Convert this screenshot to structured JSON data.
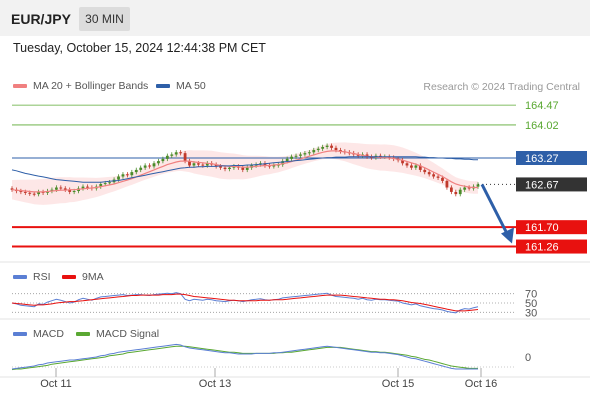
{
  "header": {
    "symbol": "EUR/JPY",
    "interval": "30 MIN",
    "datetime": "Tuesday, October 15, 2024 12:44:38 PM CET",
    "credit": "Research © 2024 Trading Central"
  },
  "legend": {
    "ma20": "MA 20 + Bollinger Bands",
    "ma50": "MA 50",
    "rsi": "RSI",
    "rsi_ma": "9MA",
    "macd": "MACD",
    "macd_signal": "MACD Signal"
  },
  "colors": {
    "ma20": "#f08080",
    "ma50": "#2e5fa8",
    "bollinger_fill": "#fde3e3",
    "candle_up": "#4a8c2a",
    "candle_down": "#c0392b",
    "resistance": "#5aa832",
    "support": "#e8110f",
    "pivot": "#2e5fa8",
    "current": "#333333",
    "arrow": "#2e5fa8",
    "rsi": "#5b7fd4",
    "rsi_ma": "#e8110f",
    "macd": "#5b7fd4",
    "macd_signal": "#5aa832"
  },
  "chart_data": [
    {
      "type": "candlestick",
      "title": "EUR/JPY",
      "x_ticks": [
        "Oct 11",
        "Oct 13",
        "Oct 15",
        "Oct 16"
      ],
      "ylim": [
        161.0,
        164.7
      ],
      "levels": [
        {
          "value": 164.47,
          "label": "164.47",
          "kind": "resistance"
        },
        {
          "value": 164.02,
          "label": "164.02",
          "kind": "resistance"
        },
        {
          "value": 163.27,
          "label": "163.27",
          "kind": "pivot"
        },
        {
          "value": 162.67,
          "label": "162.67",
          "kind": "current"
        },
        {
          "value": 161.7,
          "label": "161.70",
          "kind": "support"
        },
        {
          "value": 161.26,
          "label": "161.26",
          "kind": "support"
        }
      ],
      "closes": [
        162.55,
        162.52,
        162.5,
        162.48,
        162.46,
        162.45,
        162.5,
        162.48,
        162.52,
        162.55,
        162.6,
        162.58,
        162.55,
        162.5,
        162.52,
        162.58,
        162.62,
        162.6,
        162.58,
        162.62,
        162.68,
        162.7,
        162.72,
        162.78,
        162.85,
        162.9,
        162.88,
        162.95,
        163.0,
        163.05,
        163.1,
        163.08,
        163.15,
        163.2,
        163.25,
        163.32,
        163.35,
        163.4,
        163.38,
        163.2,
        163.1,
        163.15,
        163.12,
        163.1,
        163.15,
        163.12,
        163.08,
        163.05,
        163.02,
        163.05,
        163.08,
        163.05,
        163.0,
        163.05,
        163.1,
        163.12,
        163.15,
        163.1,
        163.08,
        163.1,
        163.12,
        163.2,
        163.25,
        163.3,
        163.32,
        163.35,
        163.38,
        163.4,
        163.45,
        163.48,
        163.52,
        163.55,
        163.5,
        163.45,
        163.42,
        163.4,
        163.38,
        163.35,
        163.32,
        163.35,
        163.3,
        163.28,
        163.32,
        163.3,
        163.3,
        163.28,
        163.25,
        163.22,
        163.15,
        163.1,
        163.05,
        163.1,
        163.0,
        162.95,
        162.9,
        162.85,
        162.82,
        162.75,
        162.6,
        162.5,
        162.45,
        162.55,
        162.6,
        162.58,
        162.62,
        162.67
      ],
      "ma20": [
        162.55,
        162.54,
        162.53,
        162.52,
        162.51,
        162.5,
        162.5,
        162.5,
        162.51,
        162.52,
        162.53,
        162.54,
        162.54,
        162.55,
        162.55,
        162.56,
        162.57,
        162.58,
        162.59,
        162.6,
        162.62,
        162.64,
        162.66,
        162.68,
        162.71,
        162.74,
        162.77,
        162.8,
        162.84,
        162.88,
        162.92,
        162.96,
        163.0,
        163.04,
        163.08,
        163.12,
        163.15,
        163.18,
        163.2,
        163.2,
        163.2,
        163.18,
        163.17,
        163.16,
        163.15,
        163.14,
        163.12,
        163.1,
        163.09,
        163.08,
        163.08,
        163.07,
        163.06,
        163.06,
        163.07,
        163.08,
        163.09,
        163.1,
        163.1,
        163.11,
        163.12,
        163.14,
        163.16,
        163.19,
        163.22,
        163.25,
        163.28,
        163.31,
        163.34,
        163.37,
        163.4,
        163.42,
        163.43,
        163.43,
        163.42,
        163.41,
        163.39,
        163.37,
        163.35,
        163.33,
        163.31,
        163.3,
        163.29,
        163.28,
        163.28,
        163.27,
        163.26,
        163.24,
        163.22,
        163.19,
        163.16,
        163.13,
        163.09,
        163.05,
        163.0,
        162.95,
        162.9,
        162.85,
        162.79,
        162.73,
        162.68,
        162.65,
        162.63,
        162.61,
        162.6,
        162.6
      ],
      "ma50": [
        163.0,
        162.98,
        162.95,
        162.92,
        162.9,
        162.88,
        162.86,
        162.84,
        162.82,
        162.8,
        162.78,
        162.77,
        162.76,
        162.75,
        162.74,
        162.73,
        162.72,
        162.72,
        162.72,
        162.72,
        162.72,
        162.73,
        162.74,
        162.75,
        162.76,
        162.78,
        162.8,
        162.82,
        162.84,
        162.86,
        162.88,
        162.9,
        162.92,
        162.94,
        162.96,
        162.98,
        163.0,
        163.02,
        163.04,
        163.05,
        163.06,
        163.06,
        163.07,
        163.07,
        163.08,
        163.08,
        163.08,
        163.09,
        163.09,
        163.09,
        163.1,
        163.1,
        163.1,
        163.11,
        163.11,
        163.12,
        163.13,
        163.14,
        163.15,
        163.16,
        163.17,
        163.18,
        163.19,
        163.2,
        163.21,
        163.22,
        163.23,
        163.24,
        163.25,
        163.26,
        163.27,
        163.28,
        163.28,
        163.29,
        163.29,
        163.29,
        163.3,
        163.3,
        163.3,
        163.3,
        163.3,
        163.3,
        163.3,
        163.3,
        163.3,
        163.3,
        163.3,
        163.3,
        163.3,
        163.3,
        163.3,
        163.3,
        163.29,
        163.29,
        163.28,
        163.28,
        163.27,
        163.27,
        163.26,
        163.26,
        163.25,
        163.25,
        163.24,
        163.24,
        163.23,
        163.23
      ]
    },
    {
      "type": "line",
      "title": "RSI",
      "y_ticks": [
        70,
        50,
        30
      ],
      "ylim": [
        20,
        80
      ],
      "series": [
        {
          "name": "RSI",
          "values": [
            50,
            48,
            45,
            44,
            43,
            42,
            48,
            47,
            52,
            55,
            58,
            56,
            53,
            50,
            52,
            57,
            60,
            58,
            56,
            60,
            63,
            64,
            65,
            66,
            67,
            68,
            66,
            67,
            68,
            68,
            67,
            66,
            68,
            69,
            70,
            71,
            70,
            72,
            70,
            58,
            55,
            58,
            57,
            56,
            58,
            57,
            55,
            54,
            53,
            55,
            56,
            55,
            53,
            55,
            57,
            58,
            59,
            57,
            56,
            57,
            58,
            61,
            62,
            63,
            64,
            65,
            66,
            67,
            68,
            69,
            70,
            71,
            67,
            64,
            63,
            62,
            61,
            60,
            58,
            60,
            57,
            56,
            58,
            57,
            57,
            56,
            55,
            54,
            50,
            48,
            46,
            48,
            44,
            42,
            40,
            38,
            37,
            35,
            32,
            30,
            29,
            35,
            38,
            37,
            40,
            42
          ]
        },
        {
          "name": "9MA",
          "values": [
            50,
            49,
            48,
            47,
            46,
            45,
            46,
            46,
            47,
            48,
            50,
            51,
            52,
            53,
            53,
            54,
            55,
            56,
            57,
            58,
            59,
            60,
            61,
            62,
            63,
            64,
            65,
            66,
            66,
            67,
            67,
            67,
            67,
            67,
            68,
            68,
            68,
            69,
            69,
            68,
            66,
            64,
            63,
            62,
            61,
            60,
            59,
            58,
            57,
            56,
            56,
            55,
            55,
            55,
            55,
            55,
            56,
            56,
            56,
            57,
            57,
            57,
            58,
            59,
            60,
            61,
            62,
            63,
            64,
            65,
            66,
            67,
            67,
            67,
            67,
            66,
            65,
            64,
            63,
            62,
            61,
            60,
            59,
            58,
            58,
            57,
            57,
            56,
            55,
            53,
            51,
            50,
            49,
            47,
            45,
            43,
            41,
            39,
            37,
            35,
            33,
            33,
            33,
            34,
            35,
            36
          ]
        }
      ]
    },
    {
      "type": "line",
      "title": "MACD",
      "y_ticks": [
        0
      ],
      "ylim": [
        -0.25,
        0.25
      ],
      "series": [
        {
          "name": "MACD",
          "values": [
            -0.2,
            -0.19,
            -0.18,
            -0.17,
            -0.16,
            -0.15,
            -0.13,
            -0.12,
            -0.1,
            -0.09,
            -0.08,
            -0.07,
            -0.06,
            -0.05,
            -0.05,
            -0.04,
            -0.03,
            -0.02,
            -0.01,
            0.0,
            0.02,
            0.03,
            0.05,
            0.06,
            0.08,
            0.09,
            0.1,
            0.11,
            0.12,
            0.13,
            0.14,
            0.15,
            0.16,
            0.17,
            0.18,
            0.19,
            0.2,
            0.21,
            0.2,
            0.17,
            0.15,
            0.14,
            0.13,
            0.12,
            0.11,
            0.1,
            0.09,
            0.08,
            0.07,
            0.07,
            0.06,
            0.05,
            0.05,
            0.05,
            0.05,
            0.06,
            0.06,
            0.06,
            0.06,
            0.07,
            0.07,
            0.08,
            0.09,
            0.1,
            0.11,
            0.12,
            0.13,
            0.14,
            0.15,
            0.16,
            0.17,
            0.18,
            0.17,
            0.16,
            0.15,
            0.14,
            0.13,
            0.12,
            0.11,
            0.1,
            0.09,
            0.08,
            0.08,
            0.07,
            0.07,
            0.06,
            0.05,
            0.04,
            0.02,
            0.0,
            -0.02,
            -0.03,
            -0.05,
            -0.07,
            -0.09,
            -0.11,
            -0.13,
            -0.15,
            -0.17,
            -0.19,
            -0.2,
            -0.2,
            -0.2,
            -0.2,
            -0.2,
            -0.2
          ]
        },
        {
          "name": "MACD Signal",
          "values": [
            -0.21,
            -0.2,
            -0.2,
            -0.19,
            -0.18,
            -0.17,
            -0.16,
            -0.15,
            -0.14,
            -0.12,
            -0.11,
            -0.1,
            -0.09,
            -0.08,
            -0.07,
            -0.06,
            -0.05,
            -0.04,
            -0.03,
            -0.02,
            -0.01,
            0.0,
            0.02,
            0.03,
            0.04,
            0.05,
            0.07,
            0.08,
            0.09,
            0.1,
            0.11,
            0.12,
            0.13,
            0.14,
            0.15,
            0.16,
            0.17,
            0.18,
            0.18,
            0.18,
            0.17,
            0.16,
            0.15,
            0.14,
            0.13,
            0.12,
            0.11,
            0.1,
            0.09,
            0.08,
            0.08,
            0.07,
            0.06,
            0.06,
            0.06,
            0.06,
            0.06,
            0.06,
            0.06,
            0.06,
            0.07,
            0.07,
            0.08,
            0.08,
            0.09,
            0.1,
            0.11,
            0.12,
            0.13,
            0.14,
            0.15,
            0.16,
            0.16,
            0.16,
            0.16,
            0.15,
            0.14,
            0.13,
            0.12,
            0.11,
            0.1,
            0.09,
            0.09,
            0.08,
            0.08,
            0.07,
            0.06,
            0.05,
            0.04,
            0.03,
            0.01,
            0.0,
            -0.02,
            -0.04,
            -0.05,
            -0.07,
            -0.09,
            -0.11,
            -0.13,
            -0.15,
            -0.16,
            -0.17,
            -0.18,
            -0.19,
            -0.19,
            -0.19
          ]
        }
      ]
    }
  ]
}
